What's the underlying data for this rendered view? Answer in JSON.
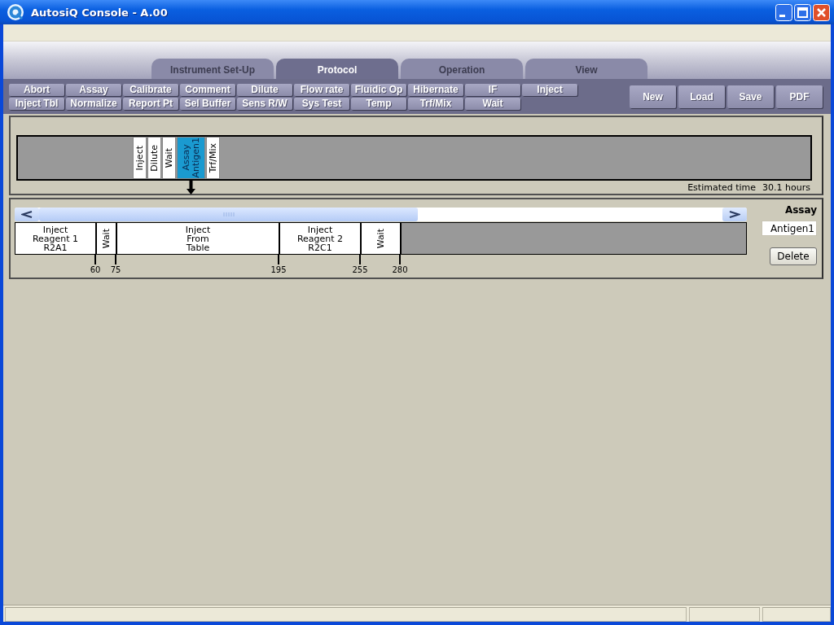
{
  "window": {
    "title": "AutosiQ Console - A.00"
  },
  "tabs": [
    {
      "label": "Instrument Set-Up",
      "selected": false
    },
    {
      "label": "Protocol",
      "selected": true
    },
    {
      "label": "Operation",
      "selected": false
    },
    {
      "label": "View",
      "selected": false
    }
  ],
  "command_rows": [
    [
      "Abort",
      "Assay",
      "Calibrate",
      "Comment",
      "Dilute",
      "Flow rate",
      "Fluidic Op",
      "Hibernate",
      "IF",
      "Inject"
    ],
    [
      "Inject Tbl",
      "Normalize",
      "Report Pt",
      "Sel Buffer",
      "Sens R/W",
      "Sys Test",
      "Temp",
      "Trf/Mix",
      "Wait"
    ]
  ],
  "file_buttons": [
    "New",
    "Load",
    "Save",
    "PDF"
  ],
  "sequence": {
    "blocks": [
      {
        "text": "Inject",
        "selected": false
      },
      {
        "text": "Dilute",
        "selected": false
      },
      {
        "text": "Wait",
        "selected": false
      },
      {
        "text": "Assay\nAntigen1",
        "selected": true
      },
      {
        "text": "Trf/Mix",
        "selected": false
      }
    ],
    "estimated_time_label": "Estimated time",
    "estimated_time": "30.1 hours"
  },
  "steps": [
    {
      "text": "Inject\nReagent 1\nR2A1",
      "kind": "horizontal",
      "end": "60"
    },
    {
      "text": "Wait",
      "kind": "vertical",
      "end": "75"
    },
    {
      "text": "Inject\nFrom\nTable",
      "kind": "horizontal",
      "end": "195"
    },
    {
      "text": "Inject\nReagent 2\nR2C1",
      "kind": "horizontal",
      "end": "255"
    },
    {
      "text": "Wait",
      "kind": "vertical",
      "end": "280"
    }
  ],
  "assay": {
    "label": "Assay",
    "value": "Antigen1",
    "button": "Delete"
  }
}
